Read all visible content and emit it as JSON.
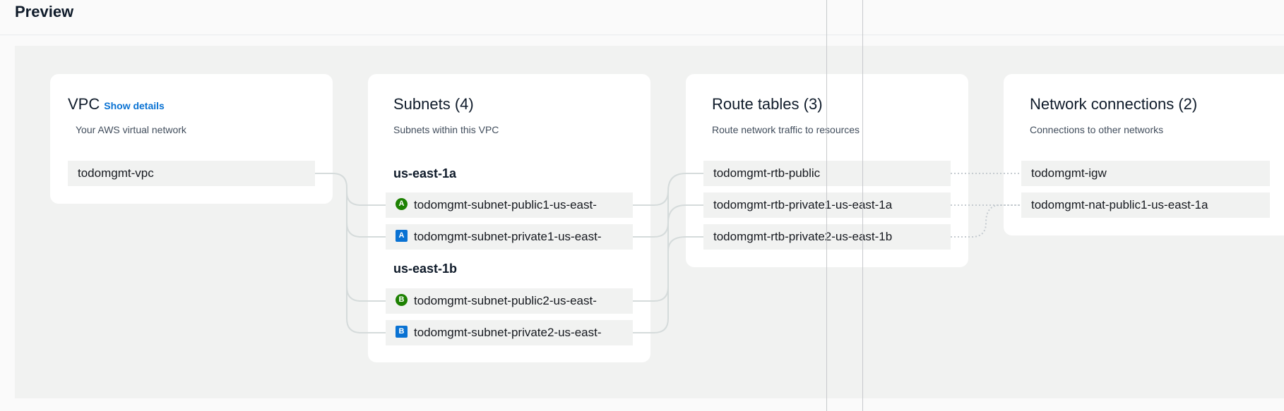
{
  "header": {
    "title": "Preview"
  },
  "vpc": {
    "title": "VPC",
    "show_details": "Show details",
    "description": "Your AWS virtual network",
    "name": "todomgmt-vpc"
  },
  "subnets": {
    "title": "Subnets (4)",
    "description": "Subnets within this VPC",
    "zones": [
      {
        "name": "us-east-1a",
        "items": [
          {
            "badge": "A",
            "type": "public",
            "label": "todomgmt-subnet-public1-us-east-"
          },
          {
            "badge": "A",
            "type": "private",
            "label": "todomgmt-subnet-private1-us-east-"
          }
        ]
      },
      {
        "name": "us-east-1b",
        "items": [
          {
            "badge": "B",
            "type": "public",
            "label": "todomgmt-subnet-public2-us-east-"
          },
          {
            "badge": "B",
            "type": "private",
            "label": "todomgmt-subnet-private2-us-east-"
          }
        ]
      }
    ]
  },
  "route_tables": {
    "title": "Route tables (3)",
    "description": "Route network traffic to resources",
    "items": [
      "todomgmt-rtb-public",
      "todomgmt-rtb-private1-us-east-1a",
      "todomgmt-rtb-private2-us-east-1b"
    ]
  },
  "network_connections": {
    "title": "Network connections (2)",
    "description": "Connections to other networks",
    "items": [
      "todomgmt-igw",
      "todomgmt-nat-public1-us-east-1a"
    ]
  },
  "colors": {
    "public_badge": "#1d8102",
    "private_badge": "#0972d3",
    "link": "#0972d3"
  }
}
